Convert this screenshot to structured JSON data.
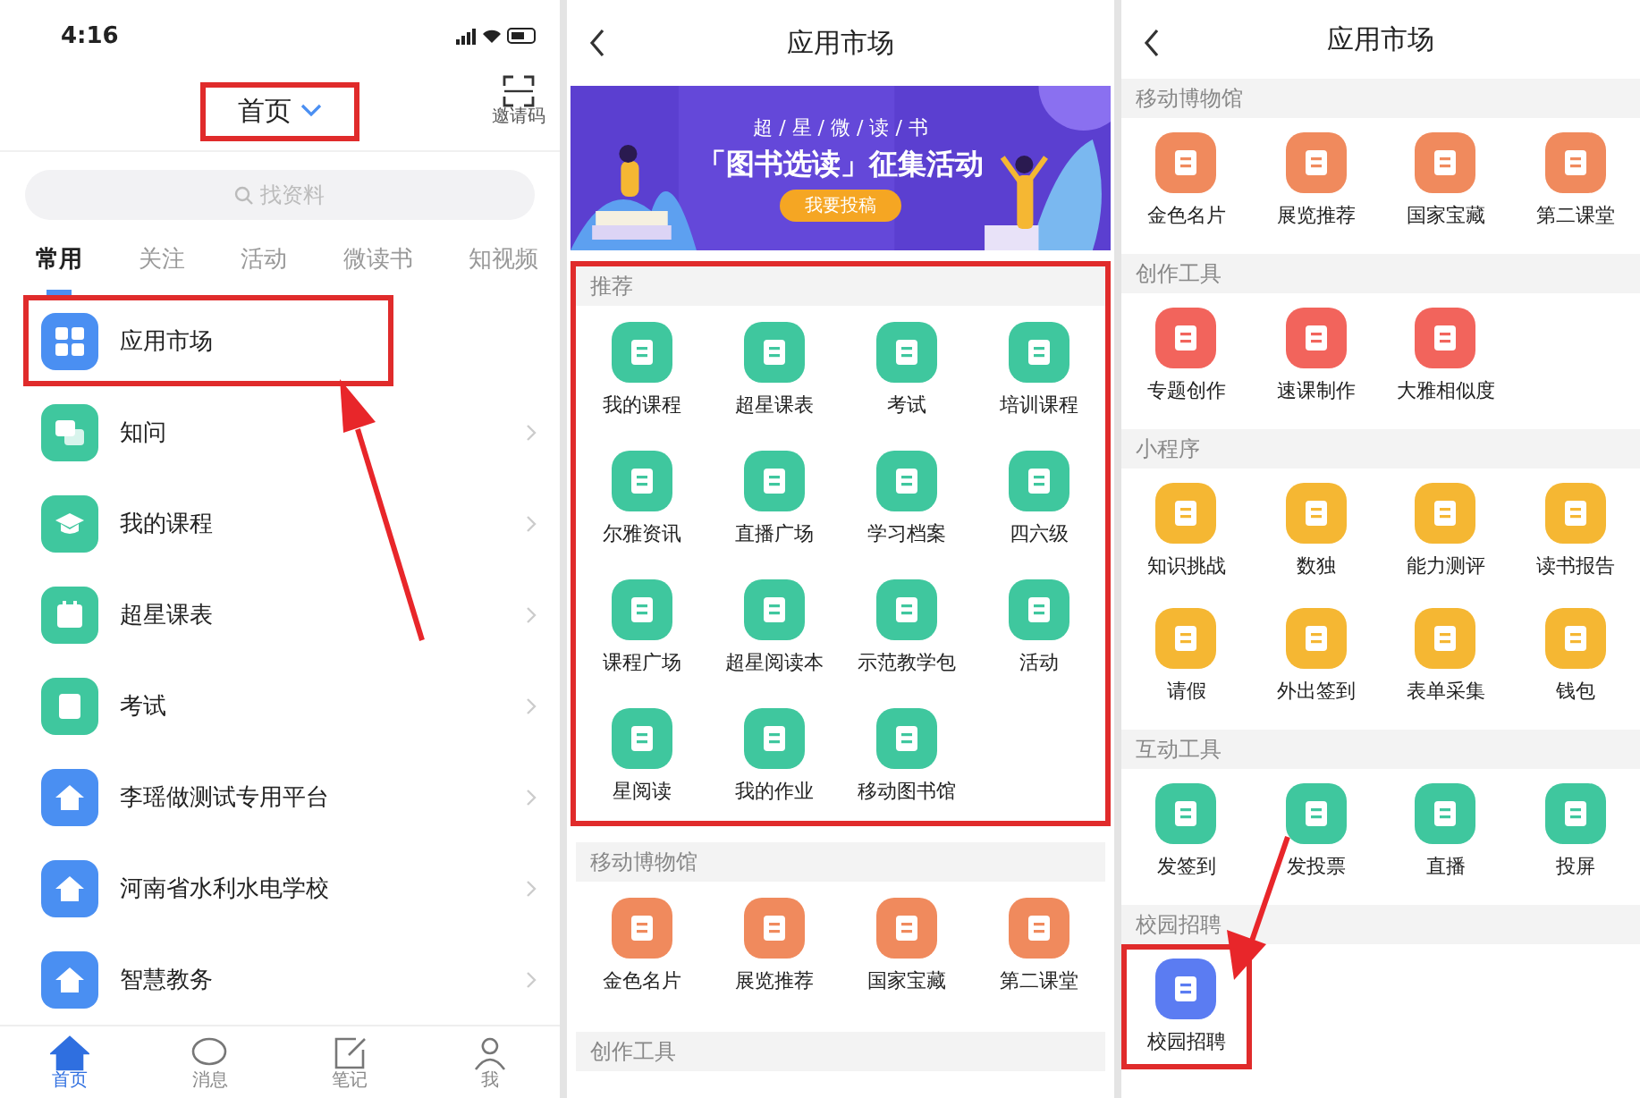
{
  "home": {
    "status_time": "4:16",
    "title": "首页",
    "title_highlighted": true,
    "scan_label": "邀请码",
    "search": {
      "placeholder": "找资料"
    },
    "tabs": [
      {
        "label": "常用",
        "selected": true
      },
      {
        "label": "关注",
        "selected": false
      },
      {
        "label": "活动",
        "selected": false
      },
      {
        "label": "微读书",
        "selected": false
      },
      {
        "label": "知视频",
        "selected": false
      }
    ],
    "items": [
      {
        "label": "应用市场",
        "kind": "grid",
        "color": "#4a8ff2",
        "highlighted": true
      },
      {
        "label": "知问",
        "kind": "chat",
        "color": "#3fc79e",
        "highlighted": false
      },
      {
        "label": "我的课程",
        "kind": "cap",
        "color": "#3fc79e",
        "highlighted": false
      },
      {
        "label": "超星课表",
        "kind": "calendar",
        "color": "#3fc79e",
        "highlighted": false
      },
      {
        "label": "考试",
        "kind": "paper",
        "color": "#3fc79e",
        "highlighted": false
      },
      {
        "label": "李瑶做测试专用平台",
        "kind": "home",
        "color": "#4a8ff2",
        "highlighted": false
      },
      {
        "label": "河南省水利水电学校",
        "kind": "home",
        "color": "#4a8ff2",
        "highlighted": false
      },
      {
        "label": "智慧教务",
        "kind": "home",
        "color": "#4a8ff2",
        "highlighted": false
      }
    ],
    "nav": [
      {
        "label": "首页",
        "kind": "home",
        "selected": true
      },
      {
        "label": "消息",
        "kind": "chat",
        "selected": false
      },
      {
        "label": "笔记",
        "kind": "note",
        "selected": false
      },
      {
        "label": "我",
        "kind": "person",
        "selected": false
      }
    ]
  },
  "market_1": {
    "title": "应用市场",
    "banner": {
      "line_1": "超 / 星 / 微 / 读 / 书",
      "headline": "「图书选读」征集活动",
      "button": "我要投稿"
    },
    "sections": [
      {
        "title": "推荐",
        "color": "#3fc79e",
        "highlighted": true,
        "apps": [
          {
            "label": "我的课程",
            "highlighted": false
          },
          {
            "label": "超星课表",
            "highlighted": false
          },
          {
            "label": "考试",
            "highlighted": false
          },
          {
            "label": "培训课程",
            "highlighted": false
          },
          {
            "label": "尔雅资讯",
            "highlighted": false
          },
          {
            "label": "直播广场",
            "highlighted": false
          },
          {
            "label": "学习档案",
            "highlighted": false
          },
          {
            "label": "四六级",
            "highlighted": false
          },
          {
            "label": "课程广场",
            "highlighted": false
          },
          {
            "label": "超星阅读本",
            "highlighted": false
          },
          {
            "label": "示范教学包",
            "highlighted": false
          },
          {
            "label": "活动",
            "highlighted": false
          },
          {
            "label": "星阅读",
            "highlighted": false
          },
          {
            "label": "我的作业",
            "highlighted": false
          },
          {
            "label": "移动图书馆",
            "highlighted": false
          }
        ]
      },
      {
        "title": "移动博物馆",
        "color": "#f08a5d",
        "highlighted": false,
        "apps": [
          {
            "label": "金色名片",
            "highlighted": false
          },
          {
            "label": "展览推荐",
            "highlighted": false
          },
          {
            "label": "国家宝藏",
            "highlighted": false
          },
          {
            "label": "第二课堂",
            "highlighted": false
          }
        ]
      },
      {
        "title": "创作工具",
        "highlighted": false
      }
    ]
  },
  "market_2": {
    "title": "应用市场",
    "sections": [
      {
        "title": "移动博物馆",
        "color": "#f08a5d",
        "apps": [
          {
            "label": "金色名片",
            "highlighted": false
          },
          {
            "label": "展览推荐",
            "highlighted": false
          },
          {
            "label": "国家宝藏",
            "highlighted": false
          },
          {
            "label": "第二课堂",
            "highlighted": false
          }
        ]
      },
      {
        "title": "创作工具",
        "color": "#f2645c",
        "apps": [
          {
            "label": "专题创作",
            "highlighted": false
          },
          {
            "label": "速课制作",
            "highlighted": false
          },
          {
            "label": "大雅相似度",
            "highlighted": false
          }
        ]
      },
      {
        "title": "小程序",
        "color": "#f5b733",
        "apps": [
          {
            "label": "知识挑战",
            "highlighted": false
          },
          {
            "label": "数独",
            "highlighted": false
          },
          {
            "label": "能力测评",
            "highlighted": false
          },
          {
            "label": "读书报告",
            "highlighted": false
          },
          {
            "label": "请假",
            "highlighted": false
          },
          {
            "label": "外出签到",
            "highlighted": false
          },
          {
            "label": "表单采集",
            "highlighted": false
          },
          {
            "label": "钱包",
            "highlighted": false
          }
        ]
      },
      {
        "title": "互动工具",
        "color": "#3fc79e",
        "apps": [
          {
            "label": "发签到",
            "highlighted": false
          },
          {
            "label": "发投票",
            "highlighted": false
          },
          {
            "label": "直播",
            "highlighted": false
          },
          {
            "label": "投屏",
            "highlighted": false
          }
        ]
      },
      {
        "title": "校园招聘",
        "color": "#5b7cf2",
        "apps": [
          {
            "label": "校园招聘",
            "highlighted": true
          }
        ]
      }
    ]
  }
}
